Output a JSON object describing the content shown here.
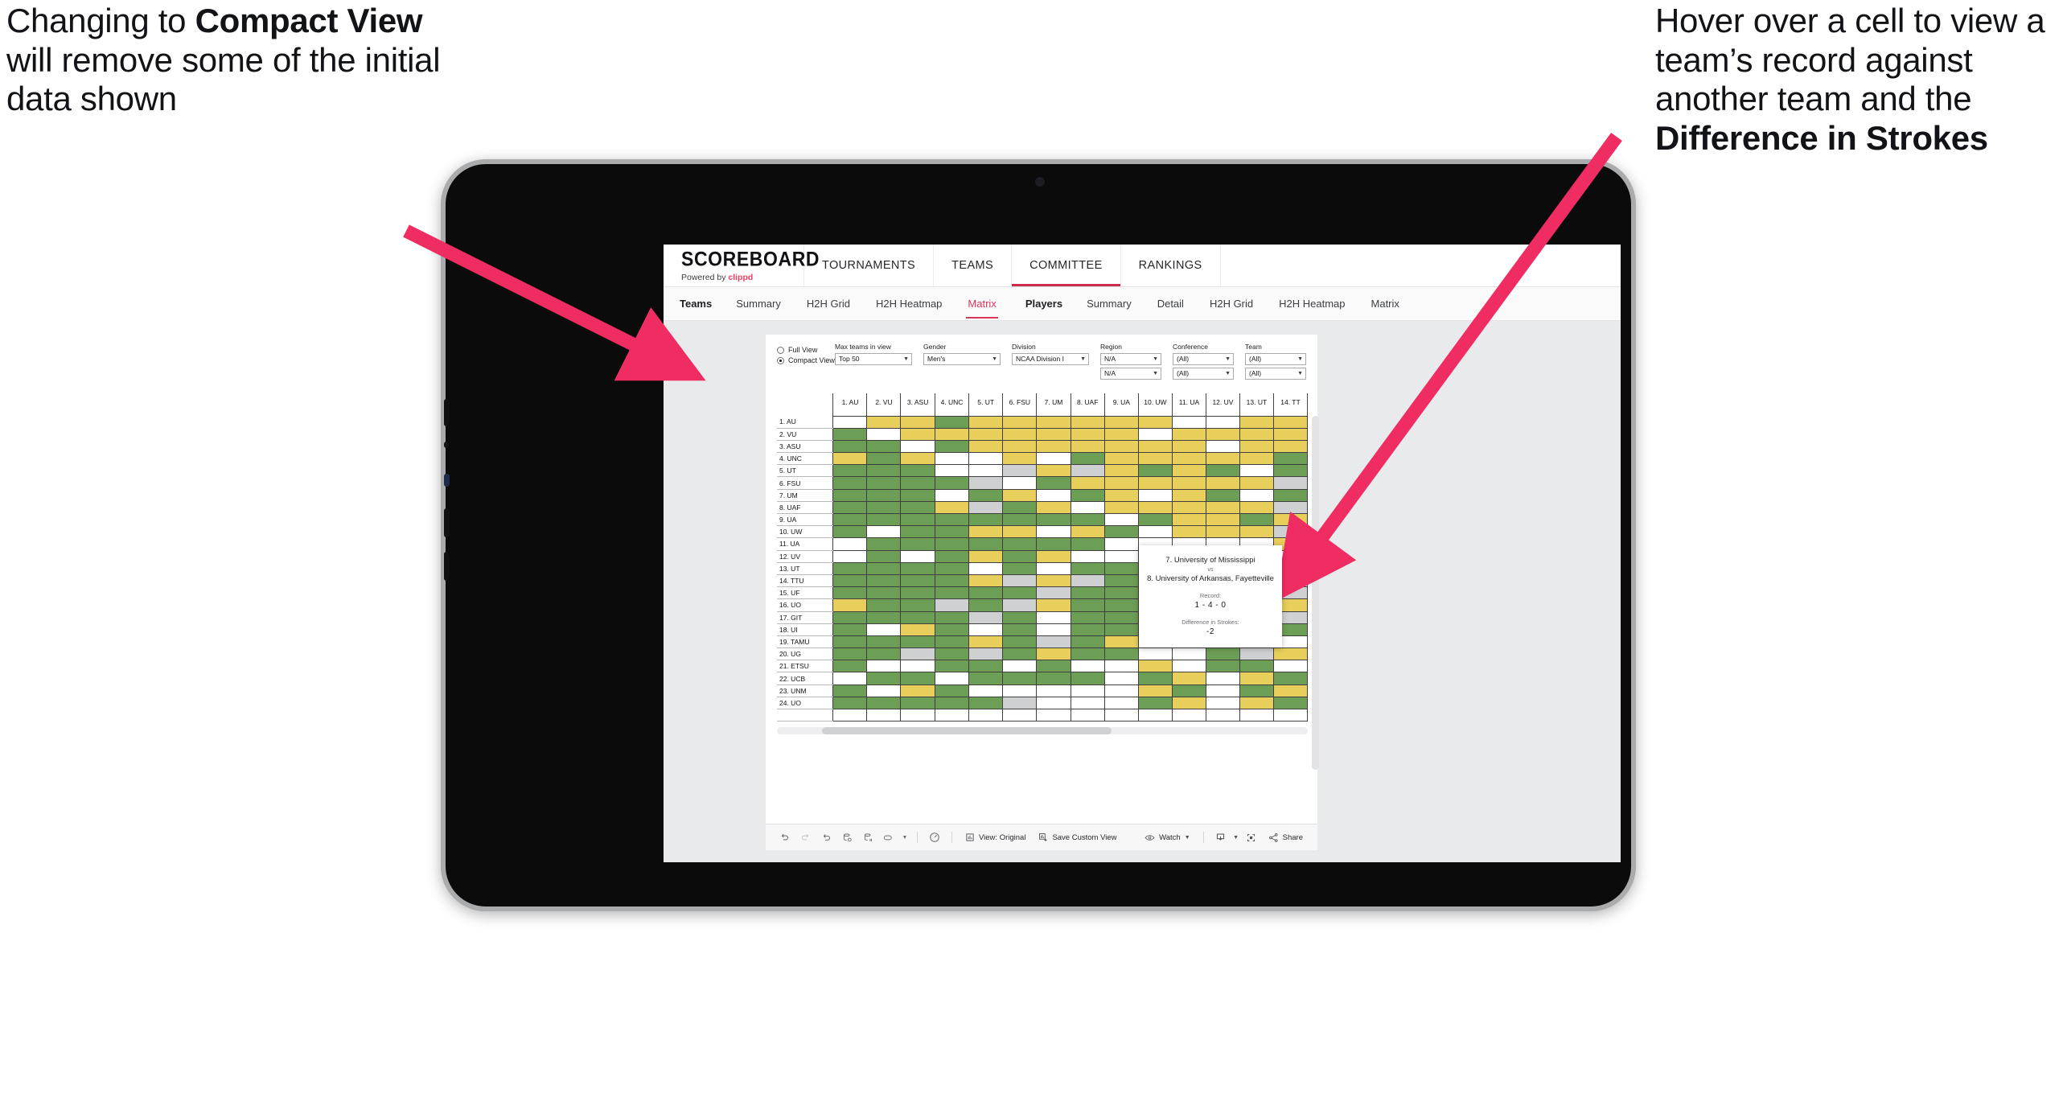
{
  "annotations": {
    "left": {
      "pre": "Changing to ",
      "bold": "Compact View",
      "post": " will remove some of the initial data shown"
    },
    "right": {
      "pre": "Hover over a cell to view a team’s record against another team and the ",
      "bold": "Difference in Strokes",
      "post": ""
    },
    "arrow_color": "#ef2d63"
  },
  "app": {
    "brand": {
      "title": "SCOREBOARD",
      "powered_prefix": "Powered by ",
      "powered_brand": "clippd"
    },
    "topnav": [
      {
        "label": "TOURNAMENTS",
        "active": false
      },
      {
        "label": "TEAMS",
        "active": false
      },
      {
        "label": "COMMITTEE",
        "active": true
      },
      {
        "label": "RANKINGS",
        "active": false
      }
    ],
    "subnav": {
      "group1_lead": "Teams",
      "group1": [
        {
          "label": "Summary",
          "active": false
        },
        {
          "label": "H2H Grid",
          "active": false
        },
        {
          "label": "H2H Heatmap",
          "active": false
        },
        {
          "label": "Matrix",
          "active": true
        }
      ],
      "group2_lead": "Players",
      "group2": [
        {
          "label": "Summary",
          "active": false
        },
        {
          "label": "Detail",
          "active": false
        },
        {
          "label": "H2H Grid",
          "active": false
        },
        {
          "label": "H2H Heatmap",
          "active": false
        },
        {
          "label": "Matrix",
          "active": false
        }
      ]
    },
    "filters": {
      "view_mode": {
        "full_label": "Full View",
        "compact_label": "Compact View",
        "selected": "Compact View"
      },
      "max_teams": {
        "label": "Max teams in view",
        "value": "Top 50"
      },
      "gender": {
        "label": "Gender",
        "value": "Men's"
      },
      "division": {
        "label": "Division",
        "value": "NCAA Division I"
      },
      "region": {
        "label": "Region",
        "value1": "N/A",
        "value2": "N/A"
      },
      "conference": {
        "label": "Conference",
        "value1": "(All)",
        "value2": "(All)"
      },
      "team": {
        "label": "Team",
        "value1": "(All)",
        "value2": "(All)"
      }
    },
    "matrix": {
      "columns": [
        "1. AU",
        "2. VU",
        "3. ASU",
        "4. UNC",
        "5. UT",
        "6. FSU",
        "7. UM",
        "8. UAF",
        "9. UA",
        "10. UW",
        "11. UA",
        "12. UV",
        "13. UT",
        "14. TT"
      ],
      "rows": [
        "1. AU",
        "2. VU",
        "3. ASU",
        "4. UNC",
        "5. UT",
        "6. FSU",
        "7. UM",
        "8. UAF",
        "9. UA",
        "10. UW",
        "11. UA",
        "12. UV",
        "13. UT",
        "14. TTU",
        "15. UF",
        "16. UO",
        "17. GIT",
        "18. UI",
        "19. TAMU",
        "20. UG",
        "21. ETSU",
        "22. UCB",
        "23. UNM",
        "24. UO"
      ],
      "legend_colors": {
        "win": "#6d9e55",
        "loss": "#e8ce5a",
        "tie": "#cfd0d2",
        "none": "#ffffff"
      },
      "cells": [
        [
          "e",
          "y",
          "y",
          "g",
          "y",
          "y",
          "y",
          "y",
          "y",
          "y",
          "w",
          "w",
          "y",
          "y"
        ],
        [
          "g",
          "e",
          "y",
          "y",
          "y",
          "y",
          "y",
          "y",
          "y",
          "w",
          "y",
          "y",
          "y",
          "y"
        ],
        [
          "g",
          "g",
          "e",
          "g",
          "y",
          "y",
          "y",
          "y",
          "y",
          "y",
          "y",
          "w",
          "y",
          "y"
        ],
        [
          "y",
          "g",
          "y",
          "e",
          "w",
          "y",
          "w",
          "g",
          "y",
          "y",
          "y",
          "y",
          "y",
          "g"
        ],
        [
          "g",
          "g",
          "g",
          "w",
          "e",
          "s",
          "y",
          "s",
          "y",
          "g",
          "y",
          "g",
          "w",
          "g"
        ],
        [
          "g",
          "g",
          "g",
          "g",
          "s",
          "e",
          "g",
          "y",
          "y",
          "y",
          "y",
          "y",
          "y",
          "s"
        ],
        [
          "g",
          "g",
          "g",
          "w",
          "g",
          "y",
          "e",
          "g",
          "y",
          "w",
          "y",
          "g",
          "w",
          "g"
        ],
        [
          "g",
          "g",
          "g",
          "y",
          "s",
          "g",
          "y",
          "e",
          "y",
          "y",
          "y",
          "y",
          "y",
          "s"
        ],
        [
          "g",
          "g",
          "g",
          "g",
          "g",
          "g",
          "g",
          "g",
          "e",
          "g",
          "y",
          "y",
          "g",
          "y"
        ],
        [
          "g",
          "w",
          "g",
          "g",
          "y",
          "y",
          "w",
          "y",
          "g",
          "e",
          "y",
          "y",
          "y",
          "s"
        ],
        [
          "w",
          "g",
          "g",
          "g",
          "g",
          "g",
          "g",
          "g",
          "w",
          "w",
          "e",
          "w",
          "w",
          "y"
        ],
        [
          "w",
          "g",
          "w",
          "g",
          "y",
          "g",
          "y",
          "w",
          "w",
          "w",
          "y",
          "e",
          "g",
          "w"
        ],
        [
          "g",
          "g",
          "g",
          "g",
          "w",
          "g",
          "w",
          "g",
          "g",
          "g",
          "g",
          "g",
          "e",
          "w"
        ],
        [
          "g",
          "g",
          "g",
          "g",
          "y",
          "s",
          "y",
          "s",
          "g",
          "g",
          "g",
          "g",
          "y",
          "e"
        ],
        [
          "g",
          "g",
          "g",
          "g",
          "g",
          "g",
          "s",
          "g",
          "g",
          "g",
          "g",
          "g",
          "y",
          "s"
        ],
        [
          "y",
          "g",
          "g",
          "s",
          "g",
          "s",
          "y",
          "g",
          "g",
          "g",
          "g",
          "g",
          "g",
          "y"
        ],
        [
          "g",
          "g",
          "g",
          "g",
          "s",
          "g",
          "w",
          "g",
          "g",
          "s",
          "g",
          "g",
          "s",
          "s"
        ],
        [
          "g",
          "w",
          "y",
          "g",
          "w",
          "g",
          "w",
          "g",
          "g",
          "g",
          "w",
          "g",
          "g",
          "g"
        ],
        [
          "g",
          "g",
          "g",
          "g",
          "y",
          "g",
          "s",
          "g",
          "y",
          "g",
          "g",
          "g",
          "y",
          "w"
        ],
        [
          "g",
          "g",
          "s",
          "g",
          "s",
          "g",
          "y",
          "g",
          "g",
          "w",
          "w",
          "g",
          "s",
          "y"
        ],
        [
          "g",
          "w",
          "w",
          "g",
          "g",
          "w",
          "g",
          "w",
          "w",
          "y",
          "w",
          "g",
          "g",
          "w"
        ],
        [
          "w",
          "g",
          "g",
          "w",
          "g",
          "g",
          "g",
          "g",
          "w",
          "g",
          "y",
          "w",
          "y",
          "g"
        ],
        [
          "g",
          "w",
          "y",
          "g",
          "w",
          "w",
          "w",
          "w",
          "w",
          "y",
          "g",
          "w",
          "g",
          "y"
        ],
        [
          "g",
          "g",
          "g",
          "g",
          "g",
          "s",
          "w",
          "w",
          "w",
          "g",
          "y",
          "w",
          "y",
          "g"
        ]
      ]
    },
    "tooltip": {
      "team_a": "7. University of Mississippi",
      "vs": "vs",
      "team_b": "8. University of Arkansas, Fayetteville",
      "record_label": "Record:",
      "record_value": "1 - 4 - 0",
      "diff_label": "Difference in Strokes:",
      "diff_value": "-2"
    },
    "toolbar": {
      "icons": [
        "undo-icon",
        "redo-icon",
        "revert-icon",
        "refresh-icon",
        "pause-icon",
        "capsule-icon"
      ],
      "view_label": "View: Original",
      "save_label": "Save Custom View",
      "watch_label": "Watch",
      "share_label": "Share"
    }
  }
}
